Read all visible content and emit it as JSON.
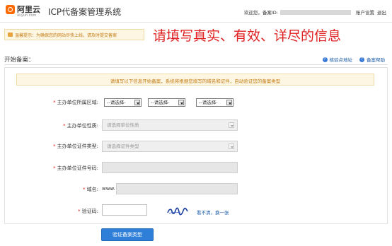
{
  "header": {
    "logo_cn": "阿里云",
    "logo_en": "aliyun.com",
    "app_title": "ICP代备案管理系统",
    "welcome_prefix": "欢迎您，备案ID:",
    "account_settings": "账户设置",
    "logout": "退出"
  },
  "notice": {
    "text": "温馨提示：为确保您的网站尽快上线，请及时提交备案"
  },
  "annotation": {
    "text": "请填写真实、有效、详尽的信息"
  },
  "section": {
    "title": "开始备案：",
    "links": [
      "核验点地址",
      "备案帮助"
    ]
  },
  "info": {
    "text": "请填写以下信息开始备案，系统将根据您填写的域名和证件，自动验证您的备案类型"
  },
  "form": {
    "region_label": "主办单位所属区域:",
    "region_selects": [
      "--请选择-",
      "--请选择-",
      "--请选择-"
    ],
    "nature_label": "主办单位性质:",
    "nature_placeholder": "请选择单位性质",
    "cert_type_label": "主办单位证件类型:",
    "cert_type_placeholder": "请选择证件类型",
    "cert_no_label": "主办单位证件号码:",
    "domain_label": "域名:",
    "domain_prefix": "www.",
    "captcha_label": "验证码:",
    "captcha_refresh": "看不清，换一张",
    "submit_label": "验证备案类型"
  },
  "colors": {
    "accent_orange": "#ff6a00",
    "link_blue": "#1a5ba8",
    "button_blue": "#2f7fd9",
    "warning_text": "#c27b12",
    "annotation_red": "#e02020"
  }
}
